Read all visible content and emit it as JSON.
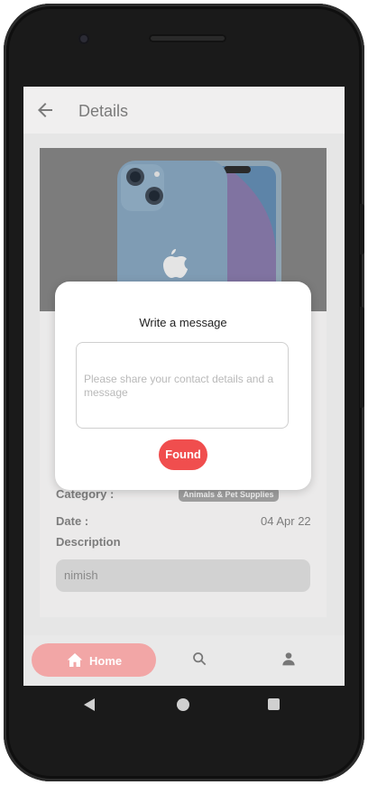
{
  "appbar": {
    "title": "Details",
    "back_icon": "arrow-back-icon"
  },
  "product": {
    "image_description": "",
    "category_label": "Category :",
    "category_value": "Animals & Pet Supplies",
    "date_label": "Date :",
    "date_value": "04 Apr 22",
    "description_label": "Description",
    "description_value": "nimish"
  },
  "dialog": {
    "title": "Write a message",
    "message_placeholder": "Please share your contact details and a message",
    "message_value": "",
    "found_button": "Found"
  },
  "bottom_nav": {
    "home_label": "Home",
    "home_icon": "home-icon",
    "search_icon": "search-icon",
    "profile_icon": "profile-icon"
  },
  "colors": {
    "accent": "#f04e4e",
    "home_pill": "#f2a6a6",
    "scrim_tint": "#7c7c7c"
  },
  "system_nav": {
    "back_icon": "nav-back-icon",
    "home_icon": "nav-home-icon",
    "recents_icon": "nav-recents-icon"
  }
}
